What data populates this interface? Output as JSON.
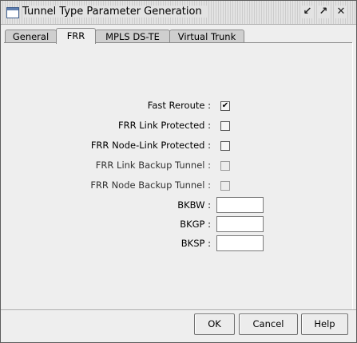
{
  "window": {
    "title": "Tunnel Type Parameter Generation",
    "controls": {
      "minimize_icon": "minimize-icon",
      "maximize_icon": "maximize-icon",
      "close_icon": "close-icon"
    }
  },
  "tabs": [
    {
      "label": "General",
      "active": false
    },
    {
      "label": "FRR",
      "active": true
    },
    {
      "label": "MPLS DS-TE",
      "active": false
    },
    {
      "label": "Virtual Trunk",
      "active": false
    }
  ],
  "frr": {
    "checkboxes": [
      {
        "label": "Fast Reroute :",
        "checked": true,
        "enabled": true
      },
      {
        "label": "FRR Link Protected :",
        "checked": false,
        "enabled": true
      },
      {
        "label": "FRR Node-Link Protected :",
        "checked": false,
        "enabled": true
      },
      {
        "label": "FRR Link Backup Tunnel :",
        "checked": false,
        "enabled": false
      },
      {
        "label": "FRR Node Backup Tunnel :",
        "checked": false,
        "enabled": false
      }
    ],
    "fields": [
      {
        "label": "BKBW :",
        "value": ""
      },
      {
        "label": "BKGP :",
        "value": ""
      },
      {
        "label": "BKSP :",
        "value": ""
      }
    ]
  },
  "buttons": {
    "ok": "OK",
    "cancel": "Cancel",
    "help": "Help"
  },
  "colors": {
    "window_bg": "#eeeeee",
    "tab_inactive": "#cfcfcf",
    "border": "#8a8a8a"
  }
}
